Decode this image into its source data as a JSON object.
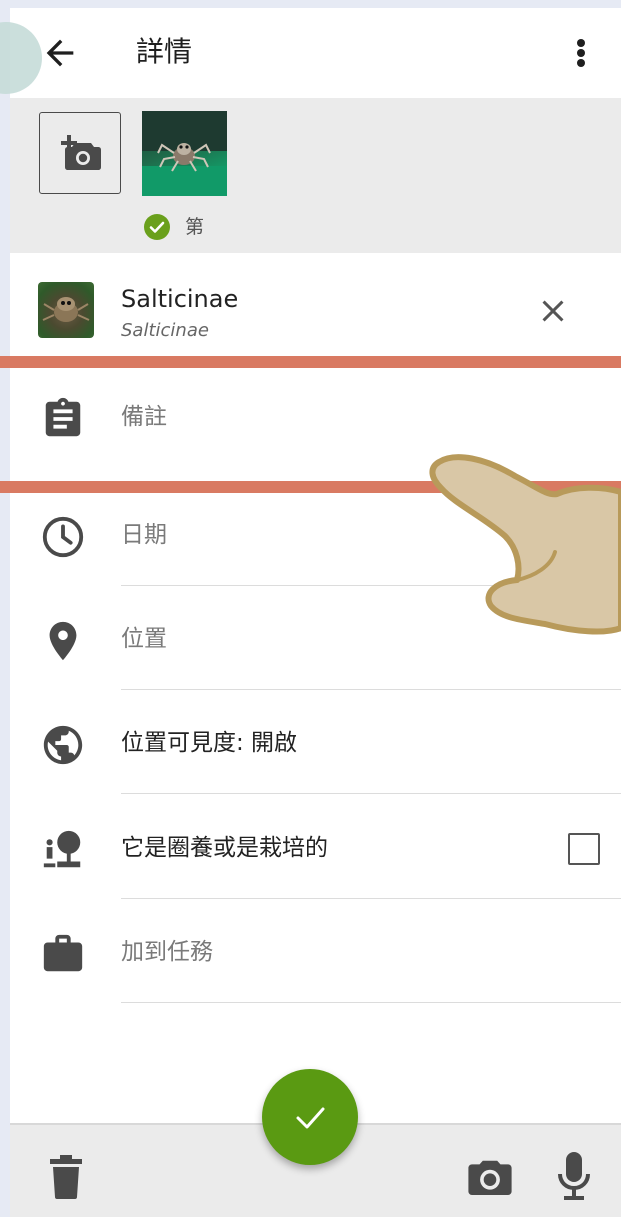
{
  "header": {
    "title": "詳情"
  },
  "photos": {
    "primary_label": "第"
  },
  "taxon": {
    "common_name": "Salticinae",
    "scientific_name": "Salticinae"
  },
  "fields": {
    "notes_placeholder": "備註",
    "date_placeholder": "日期",
    "location_placeholder": "位置",
    "geoprivacy": "位置可見度: 開啟",
    "captive": "它是圈養或是栽培的",
    "add_to_project": "加到任務"
  },
  "colors": {
    "accent_green": "#5a9a12",
    "highlight": "#d97a62",
    "icon_gray": "#4a4a4a"
  }
}
